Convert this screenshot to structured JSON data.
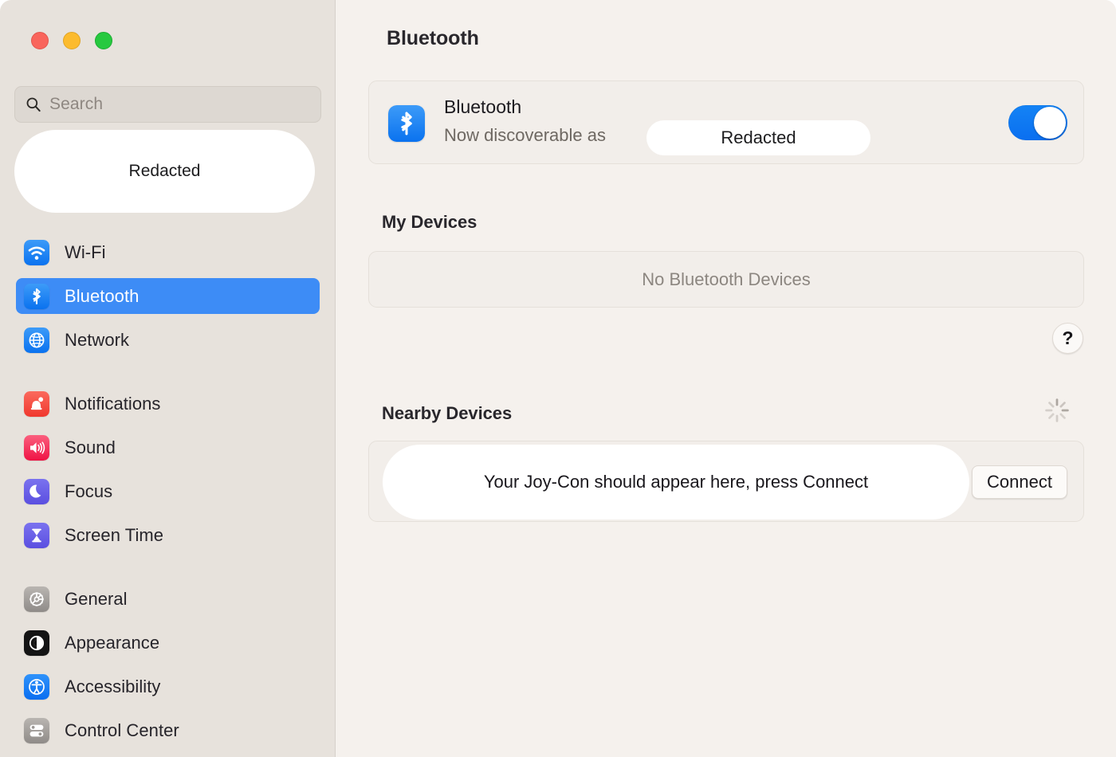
{
  "window": {
    "traffic_lights": [
      {
        "name": "close",
        "color": "#f9655c"
      },
      {
        "name": "minimize",
        "color": "#fcbb2e"
      },
      {
        "name": "maximize",
        "color": "#27c93f"
      }
    ]
  },
  "sidebar": {
    "search": {
      "placeholder": "Search",
      "value": "",
      "icon": "search-icon"
    },
    "account": {
      "label": "Redacted"
    },
    "groups": [
      {
        "id": "connectivity",
        "items": [
          {
            "label": "Wi-Fi",
            "icon": "wifi-icon",
            "selected": false
          },
          {
            "label": "Bluetooth",
            "icon": "bluetooth-icon",
            "selected": true
          },
          {
            "label": "Network",
            "icon": "globe-icon",
            "selected": false
          }
        ]
      },
      {
        "id": "system-alerts",
        "items": [
          {
            "label": "Notifications",
            "icon": "bell-icon",
            "selected": false
          },
          {
            "label": "Sound",
            "icon": "speaker-icon",
            "selected": false
          },
          {
            "label": "Focus",
            "icon": "moon-icon",
            "selected": false
          },
          {
            "label": "Screen Time",
            "icon": "hourglass-icon",
            "selected": false
          }
        ]
      },
      {
        "id": "general-settings",
        "items": [
          {
            "label": "General",
            "icon": "gear-icon",
            "selected": false
          },
          {
            "label": "Appearance",
            "icon": "appearance-icon",
            "selected": false
          },
          {
            "label": "Accessibility",
            "icon": "accessibility-icon",
            "selected": false
          },
          {
            "label": "Control Center",
            "icon": "control-center-icon",
            "selected": false
          }
        ]
      }
    ]
  },
  "main": {
    "title": "Bluetooth",
    "bluetooth_row": {
      "icon": "bluetooth-icon",
      "label": "Bluetooth",
      "subtitle": "Now discoverable as",
      "device_name": "Redacted",
      "toggle_on": true,
      "toggle_label": "Bluetooth on/off"
    },
    "my_devices": {
      "heading": "My Devices",
      "empty_text": "No Bluetooth Devices"
    },
    "help_button": {
      "glyph": "?"
    },
    "nearby_devices": {
      "heading": "Nearby Devices",
      "spinner": "progress-spinner",
      "row_text": "Your Joy-Con should appear here, press Connect",
      "connect_label": "Connect"
    }
  },
  "colors": {
    "accent_blue": "#3d8cf6",
    "toggle_blue": "#0a6ff0",
    "sidebar_bg": "#e7e2dc",
    "main_bg": "#f5f1ed",
    "card_bg": "#f2eeea"
  }
}
